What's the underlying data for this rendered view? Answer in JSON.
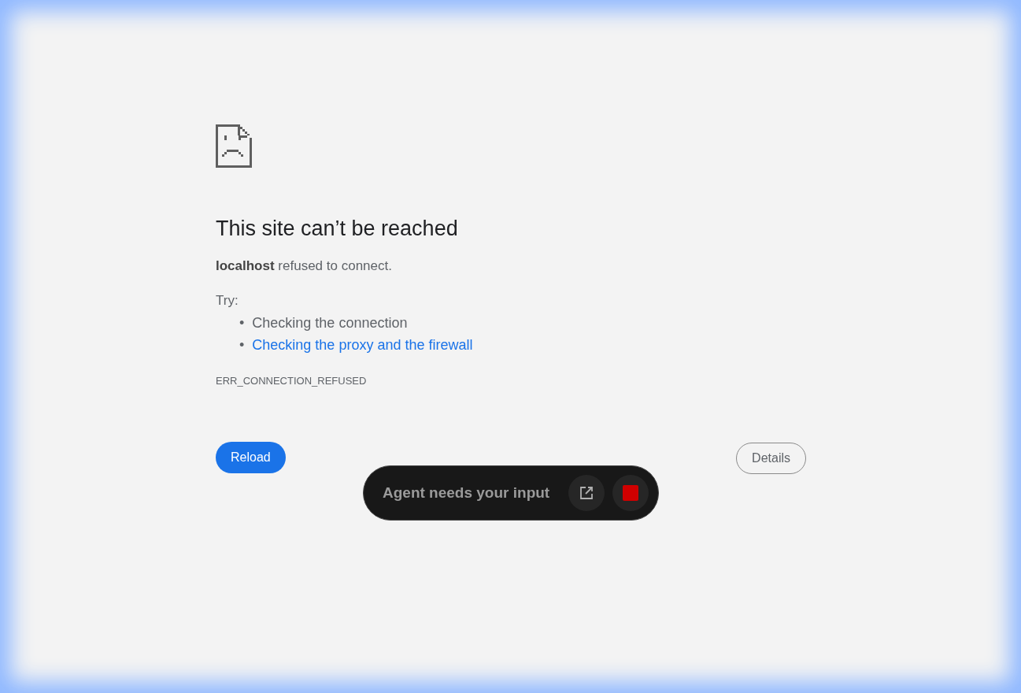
{
  "error_page": {
    "title": "This site can’t be reached",
    "message": "**localhost** refused to connect.",
    "try_label": "Try:",
    "suggestions": [
      {
        "kind": "text",
        "bullet": "•",
        "text": "Checking the connection"
      },
      {
        "kind": "link",
        "bullet": "•",
        "text": "Checking the proxy and the firewall"
      }
    ],
    "error_code": "ERR_CONNECTION_REFUSED",
    "reload_button": "Reload",
    "details_button": "Details"
  },
  "agent_banner": {
    "text": "Agent needs your input"
  }
}
